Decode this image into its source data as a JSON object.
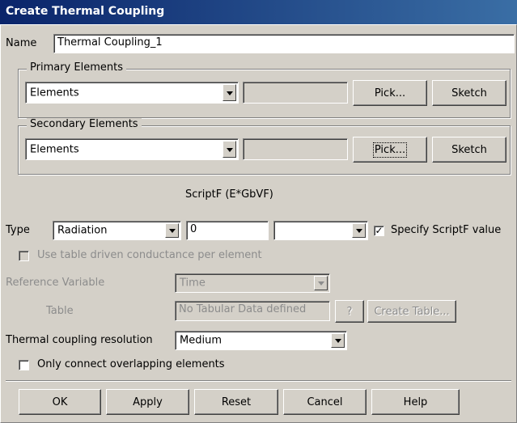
{
  "window": {
    "title": "Create Thermal Coupling"
  },
  "name": {
    "label": "Name",
    "value": "Thermal Coupling_1"
  },
  "primary": {
    "legend": "Primary Elements",
    "select": "Elements",
    "field": "",
    "pick": "Pick...",
    "sketch": "Sketch"
  },
  "secondary": {
    "legend": "Secondary Elements",
    "select": "Elements",
    "field": "",
    "pick": "Pick...",
    "sketch": "Sketch"
  },
  "script_label": "ScriptF (E*GbVF)",
  "type": {
    "label": "Type",
    "select": "Radiation",
    "value": "0",
    "unit_select": "",
    "specify_label": "Specify ScriptF value",
    "specify_checked": "✓"
  },
  "table_driven": {
    "label": "Use table driven conductance per element",
    "checked": ""
  },
  "reference": {
    "label": "Reference Variable",
    "select": "Time"
  },
  "table": {
    "label": "Table",
    "value": "No Tabular Data defined",
    "help": "?",
    "create": "Create Table..."
  },
  "resolution": {
    "label": "Thermal coupling resolution",
    "select": "Medium"
  },
  "overlap": {
    "label": "Only connect overlapping elements",
    "checked": ""
  },
  "buttons": {
    "ok": "OK",
    "apply": "Apply",
    "reset": "Reset",
    "cancel": "Cancel",
    "help": "Help"
  }
}
